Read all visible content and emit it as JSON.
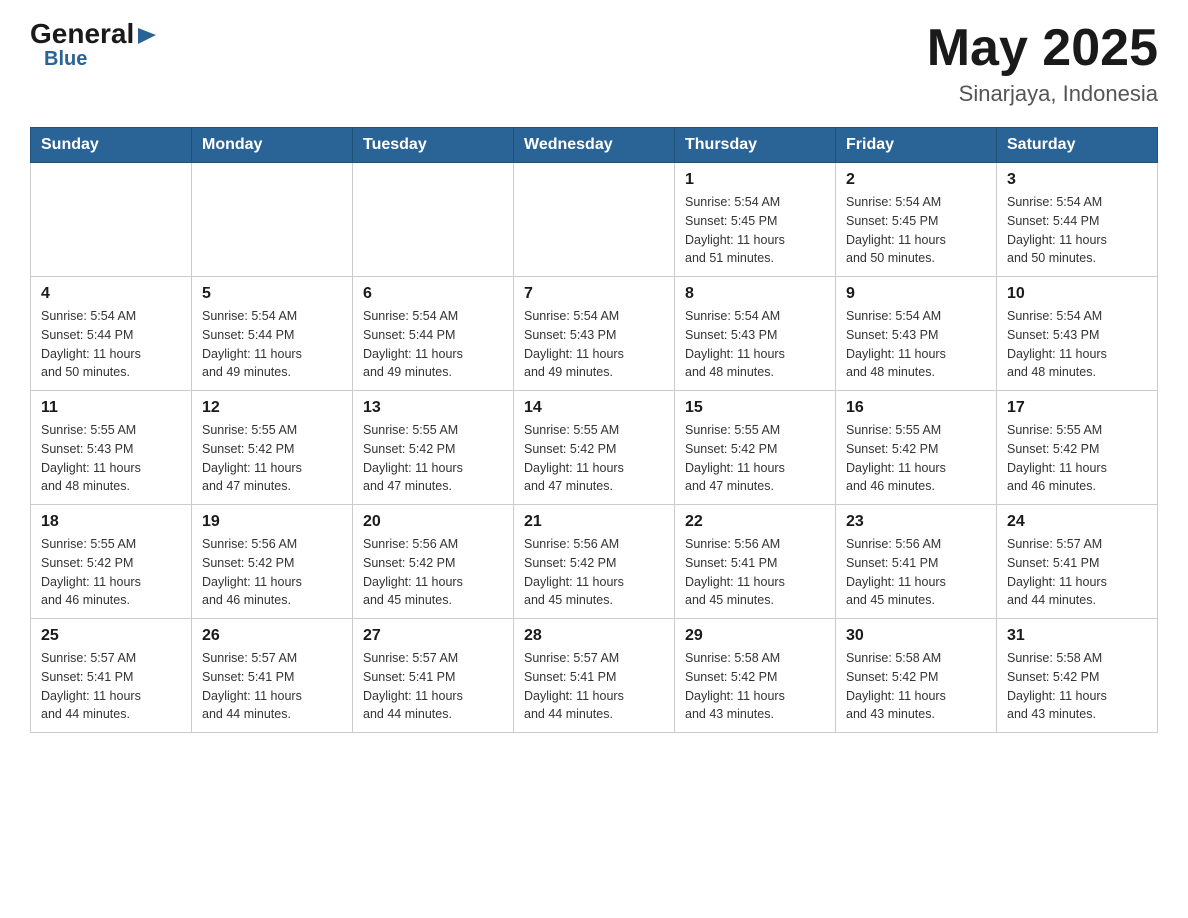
{
  "logo": {
    "general": "General",
    "triangle": "▶",
    "blue": "Blue"
  },
  "title": {
    "month_year": "May 2025",
    "location": "Sinarjaya, Indonesia"
  },
  "days_of_week": [
    "Sunday",
    "Monday",
    "Tuesday",
    "Wednesday",
    "Thursday",
    "Friday",
    "Saturday"
  ],
  "weeks": [
    [
      {
        "day": "",
        "info": ""
      },
      {
        "day": "",
        "info": ""
      },
      {
        "day": "",
        "info": ""
      },
      {
        "day": "",
        "info": ""
      },
      {
        "day": "1",
        "info": "Sunrise: 5:54 AM\nSunset: 5:45 PM\nDaylight: 11 hours\nand 51 minutes."
      },
      {
        "day": "2",
        "info": "Sunrise: 5:54 AM\nSunset: 5:45 PM\nDaylight: 11 hours\nand 50 minutes."
      },
      {
        "day": "3",
        "info": "Sunrise: 5:54 AM\nSunset: 5:44 PM\nDaylight: 11 hours\nand 50 minutes."
      }
    ],
    [
      {
        "day": "4",
        "info": "Sunrise: 5:54 AM\nSunset: 5:44 PM\nDaylight: 11 hours\nand 50 minutes."
      },
      {
        "day": "5",
        "info": "Sunrise: 5:54 AM\nSunset: 5:44 PM\nDaylight: 11 hours\nand 49 minutes."
      },
      {
        "day": "6",
        "info": "Sunrise: 5:54 AM\nSunset: 5:44 PM\nDaylight: 11 hours\nand 49 minutes."
      },
      {
        "day": "7",
        "info": "Sunrise: 5:54 AM\nSunset: 5:43 PM\nDaylight: 11 hours\nand 49 minutes."
      },
      {
        "day": "8",
        "info": "Sunrise: 5:54 AM\nSunset: 5:43 PM\nDaylight: 11 hours\nand 48 minutes."
      },
      {
        "day": "9",
        "info": "Sunrise: 5:54 AM\nSunset: 5:43 PM\nDaylight: 11 hours\nand 48 minutes."
      },
      {
        "day": "10",
        "info": "Sunrise: 5:54 AM\nSunset: 5:43 PM\nDaylight: 11 hours\nand 48 minutes."
      }
    ],
    [
      {
        "day": "11",
        "info": "Sunrise: 5:55 AM\nSunset: 5:43 PM\nDaylight: 11 hours\nand 48 minutes."
      },
      {
        "day": "12",
        "info": "Sunrise: 5:55 AM\nSunset: 5:42 PM\nDaylight: 11 hours\nand 47 minutes."
      },
      {
        "day": "13",
        "info": "Sunrise: 5:55 AM\nSunset: 5:42 PM\nDaylight: 11 hours\nand 47 minutes."
      },
      {
        "day": "14",
        "info": "Sunrise: 5:55 AM\nSunset: 5:42 PM\nDaylight: 11 hours\nand 47 minutes."
      },
      {
        "day": "15",
        "info": "Sunrise: 5:55 AM\nSunset: 5:42 PM\nDaylight: 11 hours\nand 47 minutes."
      },
      {
        "day": "16",
        "info": "Sunrise: 5:55 AM\nSunset: 5:42 PM\nDaylight: 11 hours\nand 46 minutes."
      },
      {
        "day": "17",
        "info": "Sunrise: 5:55 AM\nSunset: 5:42 PM\nDaylight: 11 hours\nand 46 minutes."
      }
    ],
    [
      {
        "day": "18",
        "info": "Sunrise: 5:55 AM\nSunset: 5:42 PM\nDaylight: 11 hours\nand 46 minutes."
      },
      {
        "day": "19",
        "info": "Sunrise: 5:56 AM\nSunset: 5:42 PM\nDaylight: 11 hours\nand 46 minutes."
      },
      {
        "day": "20",
        "info": "Sunrise: 5:56 AM\nSunset: 5:42 PM\nDaylight: 11 hours\nand 45 minutes."
      },
      {
        "day": "21",
        "info": "Sunrise: 5:56 AM\nSunset: 5:42 PM\nDaylight: 11 hours\nand 45 minutes."
      },
      {
        "day": "22",
        "info": "Sunrise: 5:56 AM\nSunset: 5:41 PM\nDaylight: 11 hours\nand 45 minutes."
      },
      {
        "day": "23",
        "info": "Sunrise: 5:56 AM\nSunset: 5:41 PM\nDaylight: 11 hours\nand 45 minutes."
      },
      {
        "day": "24",
        "info": "Sunrise: 5:57 AM\nSunset: 5:41 PM\nDaylight: 11 hours\nand 44 minutes."
      }
    ],
    [
      {
        "day": "25",
        "info": "Sunrise: 5:57 AM\nSunset: 5:41 PM\nDaylight: 11 hours\nand 44 minutes."
      },
      {
        "day": "26",
        "info": "Sunrise: 5:57 AM\nSunset: 5:41 PM\nDaylight: 11 hours\nand 44 minutes."
      },
      {
        "day": "27",
        "info": "Sunrise: 5:57 AM\nSunset: 5:41 PM\nDaylight: 11 hours\nand 44 minutes."
      },
      {
        "day": "28",
        "info": "Sunrise: 5:57 AM\nSunset: 5:41 PM\nDaylight: 11 hours\nand 44 minutes."
      },
      {
        "day": "29",
        "info": "Sunrise: 5:58 AM\nSunset: 5:42 PM\nDaylight: 11 hours\nand 43 minutes."
      },
      {
        "day": "30",
        "info": "Sunrise: 5:58 AM\nSunset: 5:42 PM\nDaylight: 11 hours\nand 43 minutes."
      },
      {
        "day": "31",
        "info": "Sunrise: 5:58 AM\nSunset: 5:42 PM\nDaylight: 11 hours\nand 43 minutes."
      }
    ]
  ]
}
